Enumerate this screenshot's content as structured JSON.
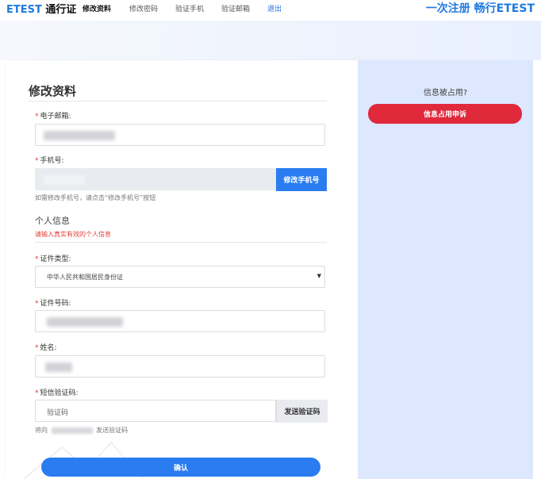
{
  "nav": {
    "brand_latin": "ETEST",
    "brand_cn": "通行证",
    "links": [
      "修改资料",
      "修改密码",
      "验证手机",
      "验证邮箱",
      "退出"
    ],
    "slogan": "一次注册 畅行ETEST"
  },
  "form": {
    "title": "修改资料",
    "email_label": "电子邮箱:",
    "phone_label": "手机号:",
    "change_phone_button": "修改手机号",
    "phone_hint": "如需修改手机号，请点击“修改手机号”按钮",
    "personal_section": "个人信息",
    "personal_note": "请输入真实有效的个人信息",
    "id_type_label": "证件类型:",
    "id_type_value": "中华人民共和国居民身份证",
    "id_number_label": "证件号码:",
    "name_label": "姓名:",
    "sms_label": "短信验证码:",
    "sms_placeholder": "验证码",
    "send_code_button": "发送验证码",
    "send_hint_prefix": "将向",
    "send_hint_suffix": "发送验证码",
    "submit_button": "确认",
    "required_mark": "*"
  },
  "side": {
    "question": "信息被占用?",
    "appeal_button": "信息占用申诉"
  },
  "colors": {
    "accent": "#2a7cf0",
    "danger": "#e0293b",
    "side_bg": "#dde7fd"
  }
}
